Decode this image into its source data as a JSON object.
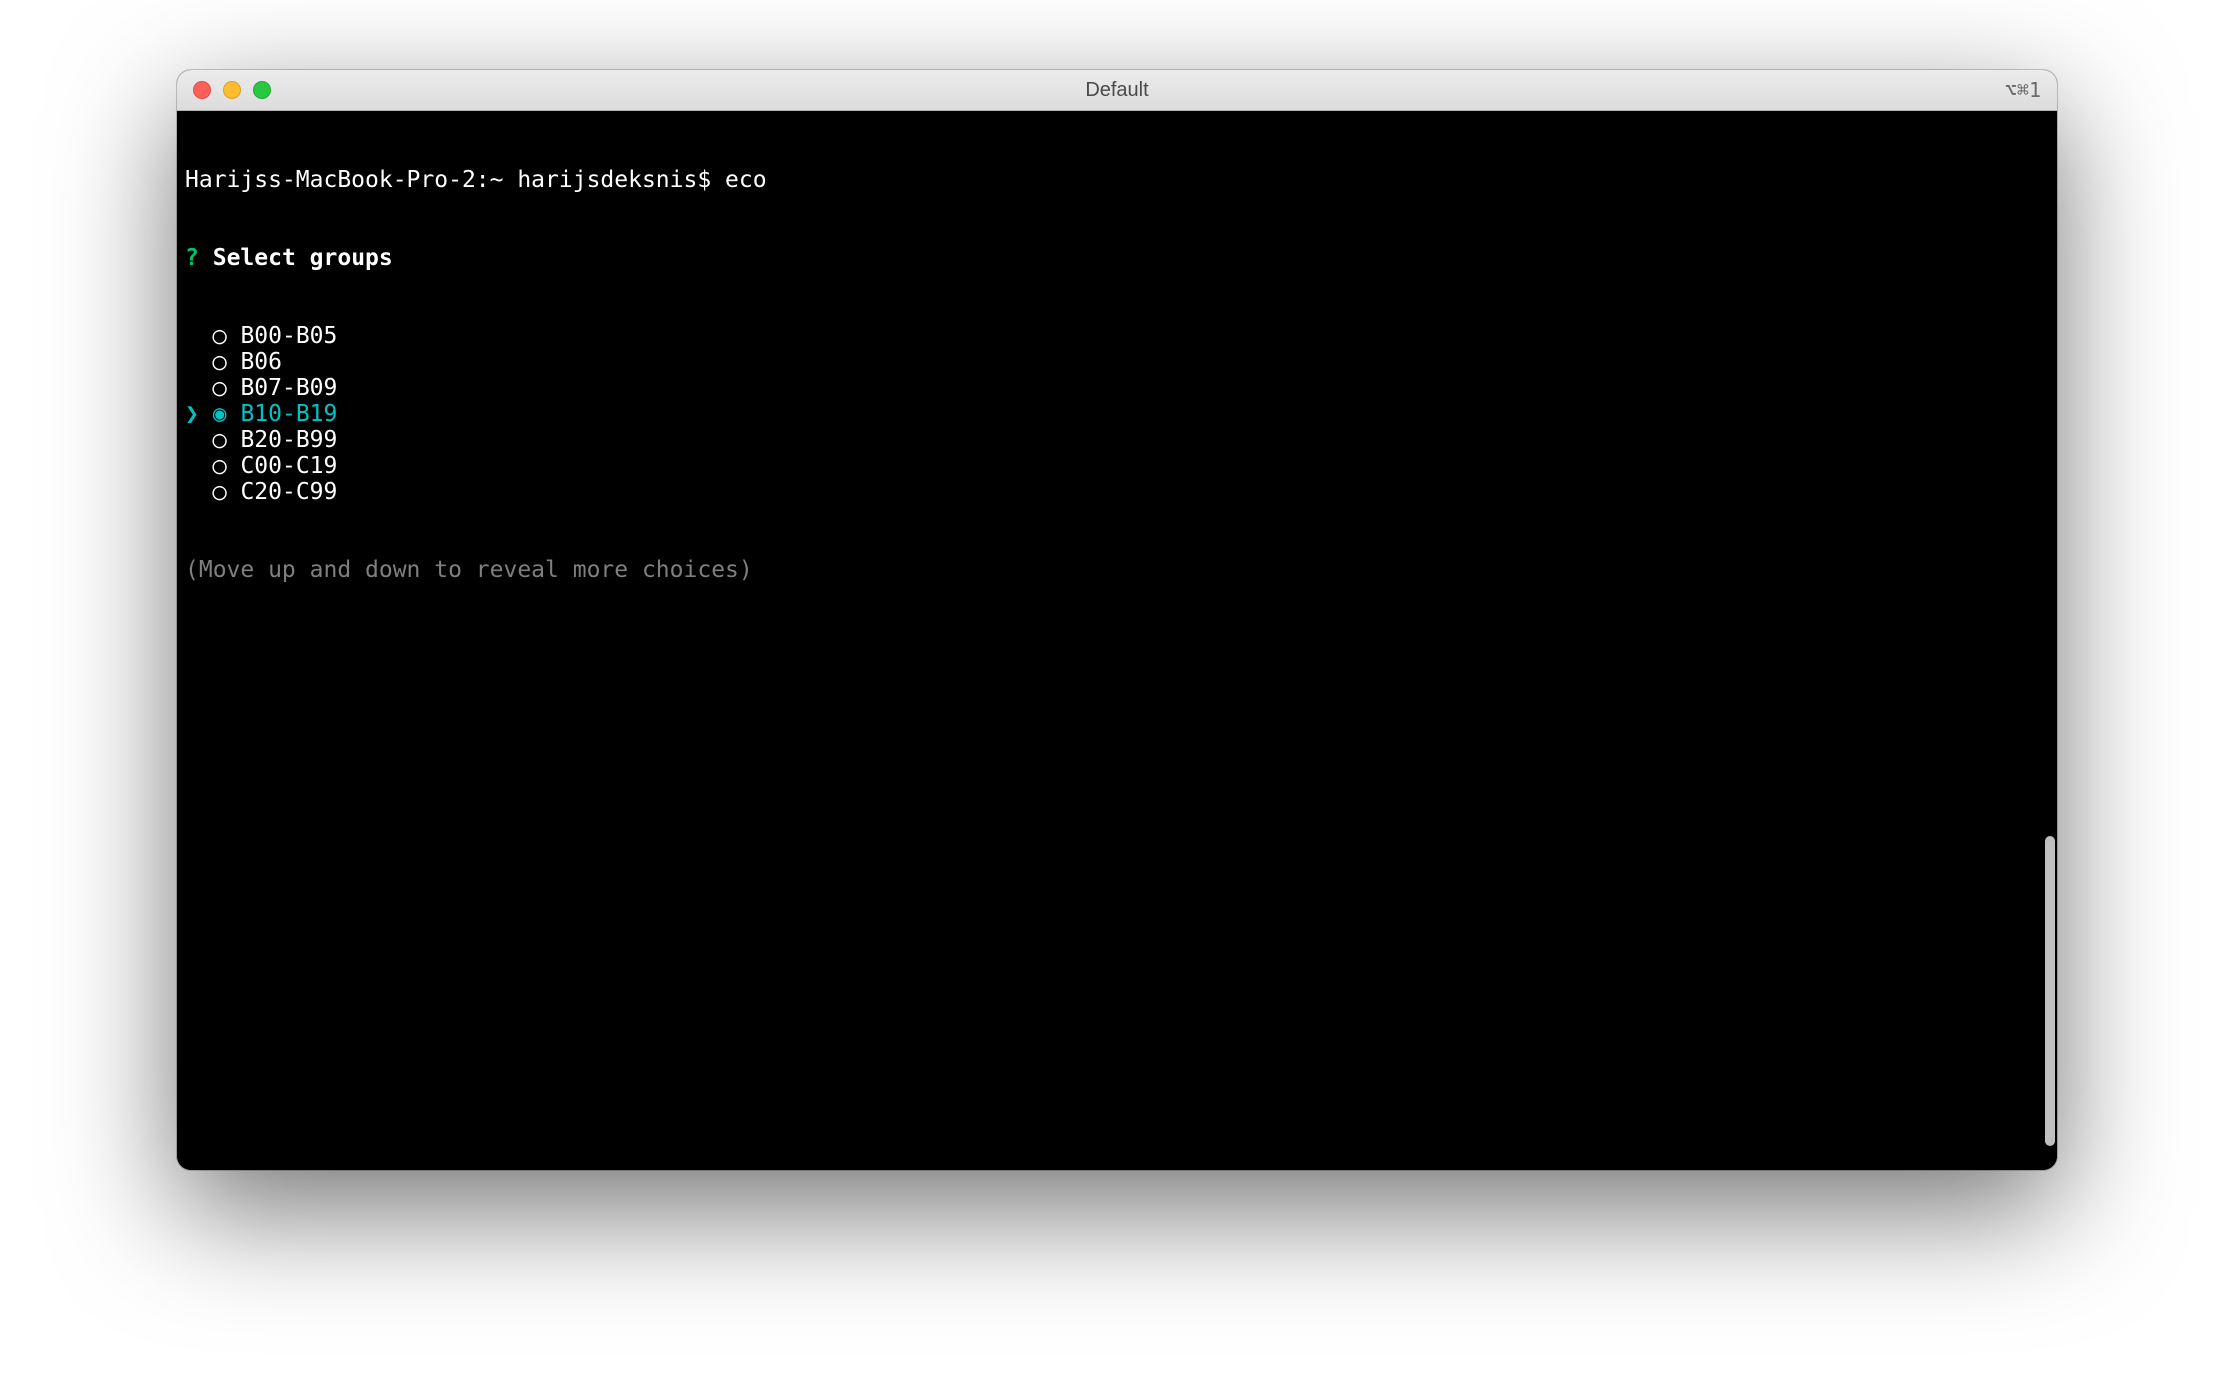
{
  "window": {
    "title": "Default",
    "shortcut": "⌥⌘1"
  },
  "prompt": {
    "host_path": "Harijss-MacBook-Pro-2:~ harijsdeksnis$ ",
    "command": "eco"
  },
  "question": {
    "marker": "?",
    "text": "Select groups"
  },
  "pointer": "❯",
  "radio_empty": "◯",
  "radio_filled": "◉",
  "options": [
    {
      "label": "B00-B05",
      "selected": false
    },
    {
      "label": "B06",
      "selected": false
    },
    {
      "label": "B07-B09",
      "selected": false
    },
    {
      "label": "B10-B19",
      "selected": true
    },
    {
      "label": "B20-B99",
      "selected": false
    },
    {
      "label": "C00-C19",
      "selected": false
    },
    {
      "label": "C20-C99",
      "selected": false
    }
  ],
  "hint": "(Move up and down to reveal more choices)",
  "colors": {
    "green": "#00c36a",
    "cyan": "#00c4c4",
    "grey": "#7f7f7f",
    "bg": "#000000",
    "fg": "#ffffff"
  }
}
